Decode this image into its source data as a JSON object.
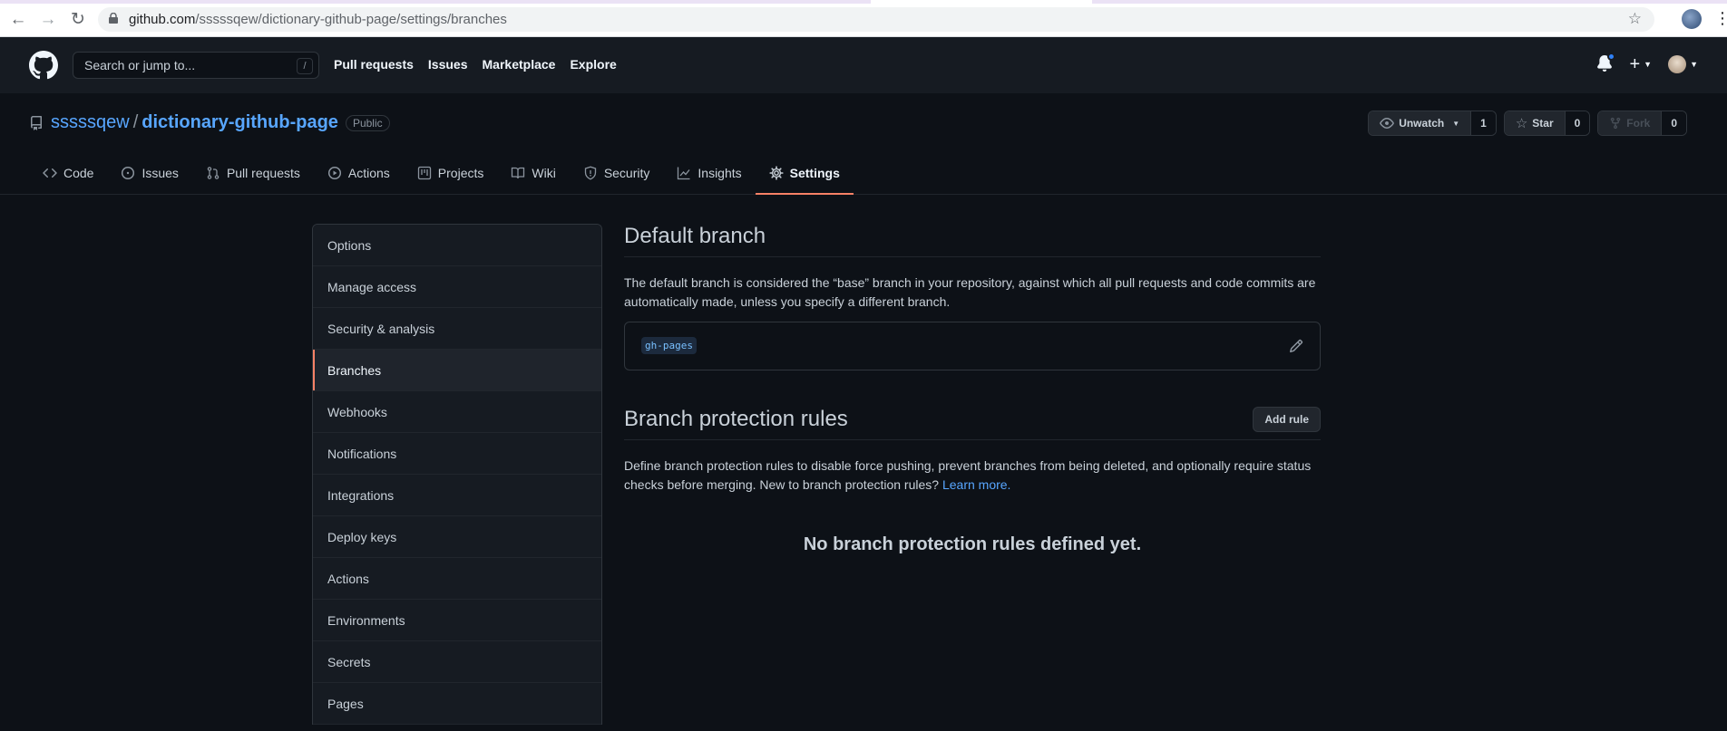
{
  "browser": {
    "url_host": "github.com",
    "url_path": "/sssssqew/dictionary-github-page/settings/branches"
  },
  "header": {
    "search_placeholder": "Search or jump to...",
    "search_shortcut": "/",
    "nav": [
      "Pull requests",
      "Issues",
      "Marketplace",
      "Explore"
    ]
  },
  "repo": {
    "owner": "sssssqew",
    "separator": "/",
    "name": "dictionary-github-page",
    "visibility": "Public",
    "watch_label": "Unwatch",
    "watch_count": "1",
    "star_label": "Star",
    "star_count": "0",
    "fork_label": "Fork",
    "fork_count": "0",
    "tabs": [
      {
        "label": "Code",
        "icon": "code-icon"
      },
      {
        "label": "Issues",
        "icon": "issue-icon"
      },
      {
        "label": "Pull requests",
        "icon": "pull-request-icon"
      },
      {
        "label": "Actions",
        "icon": "play-icon"
      },
      {
        "label": "Projects",
        "icon": "project-icon"
      },
      {
        "label": "Wiki",
        "icon": "book-icon"
      },
      {
        "label": "Security",
        "icon": "shield-icon"
      },
      {
        "label": "Insights",
        "icon": "graph-icon"
      },
      {
        "label": "Settings",
        "icon": "gear-icon"
      }
    ]
  },
  "sidebar": {
    "items": [
      "Options",
      "Manage access",
      "Security & analysis",
      "Branches",
      "Webhooks",
      "Notifications",
      "Integrations",
      "Deploy keys",
      "Actions",
      "Environments",
      "Secrets",
      "Pages"
    ]
  },
  "default_branch": {
    "title": "Default branch",
    "description": "The default branch is considered the “base” branch in your repository, against which all pull requests and code commits are automatically made, unless you specify a different branch.",
    "branch": "gh-pages"
  },
  "protection": {
    "title": "Branch protection rules",
    "add_button": "Add rule",
    "description": "Define branch protection rules to disable force pushing, prevent branches from being deleted, and optionally require status checks before merging. New to branch protection rules?",
    "learn_more": "Learn more.",
    "empty": "No branch protection rules defined yet."
  },
  "colors": {
    "accent": "#f78166",
    "link": "#58a6ff",
    "background": "#0d1117",
    "header": "#161b22"
  }
}
